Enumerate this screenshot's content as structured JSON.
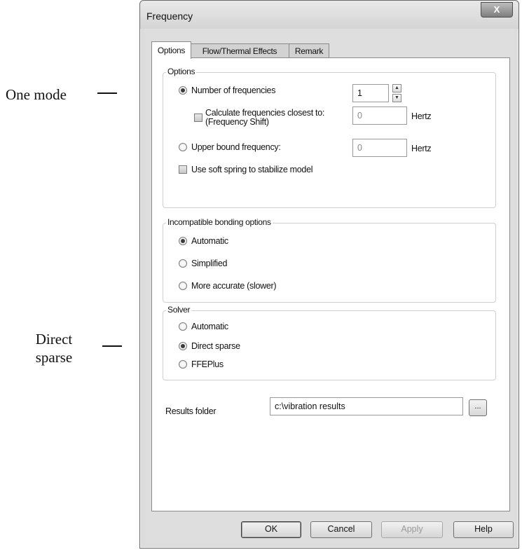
{
  "annotations": {
    "one_mode": "One mode",
    "direct_sparse": "Direct sparse"
  },
  "dialog": {
    "title": "Frequency",
    "close_symbol": "X"
  },
  "tabs": [
    "Options",
    "Flow/Thermal Effects",
    "Remark"
  ],
  "options_group": {
    "title": "Options",
    "number_of_frequencies": {
      "label": "Number of frequencies",
      "selected": true,
      "value": "1"
    },
    "closest_to": {
      "label_line1": "Calculate frequencies closest to:",
      "label_line2": "(Frequency Shift)",
      "checked": false,
      "value": "0",
      "unit": "Hertz"
    },
    "upper_bound": {
      "label": "Upper bound frequency:",
      "selected": false,
      "value": "0",
      "unit": "Hertz"
    },
    "soft_spring": {
      "label": "Use soft spring to stabilize model",
      "checked": false
    }
  },
  "bonding_group": {
    "title": "Incompatible bonding options",
    "options": [
      "Automatic",
      "Simplified",
      "More accurate (slower)"
    ],
    "selected": "Automatic"
  },
  "solver_group": {
    "title": "Solver",
    "options": [
      "Automatic",
      "Direct sparse",
      "FFEPlus"
    ],
    "selected": "Direct sparse"
  },
  "results_folder": {
    "label": "Results folder",
    "value": "c:\\vibration results",
    "browse_label": "..."
  },
  "buttons": {
    "ok": "OK",
    "cancel": "Cancel",
    "apply": "Apply",
    "help": "Help"
  }
}
